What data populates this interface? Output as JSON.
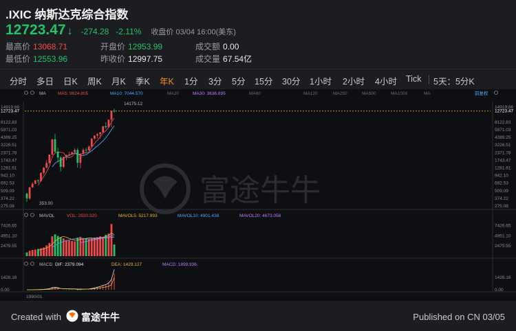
{
  "header": {
    "title": ".IXIC 纳斯达克综合指数",
    "price": "12723.47",
    "change": "-274.28",
    "change_pct": "-2.11%",
    "status": "收盘价  03/04 16:00(美东)",
    "stats": [
      {
        "label": "最高价",
        "value": "13068.71",
        "tone": "red"
      },
      {
        "label": "开盘价",
        "value": "12953.99",
        "tone": "green"
      },
      {
        "label": "成交额",
        "value": "0.00",
        "tone": "white"
      },
      {
        "label": "最低价",
        "value": "12553.96",
        "tone": "green"
      },
      {
        "label": "昨收价",
        "value": "12997.75",
        "tone": "white"
      },
      {
        "label": "成交量",
        "value": "67.54亿",
        "tone": "white"
      }
    ]
  },
  "tabs": [
    "分时",
    "多日",
    "日K",
    "周K",
    "月K",
    "季K",
    "年K",
    "1分",
    "3分",
    "5分",
    "15分",
    "30分",
    "1小时",
    "2小时",
    "4小时",
    "Tick",
    "5天：5分K"
  ],
  "active_tab": "年K",
  "main_legend": {
    "ma": "MA",
    "ma5": "MA5: 9624.805",
    "ma10": "MA10: 7044.570",
    "ma20": "MA20",
    "ma30": "MA30: 3636.695",
    "ma60": "MA60",
    "ma120": "MA120",
    "ma250": "MA250",
    "ma500": "MA500",
    "ma1000": "MA1000",
    "ma_more": "MA",
    "restore": "前复权",
    "hi_label": "14175.12",
    "lo_label": "353.00"
  },
  "yaxis_main": [
    "14919.86",
    "12723.47",
    "8122.83",
    "5971.03",
    "4389.25",
    "3226.51",
    "2371.78",
    "1743.47",
    "1281.61",
    "942.10",
    "692.53",
    "509.09",
    "374.22",
    "275.08"
  ],
  "vol_legend": {
    "name": "MAVOL",
    "vol": "VOL: 2830.320",
    "mavol5": "MAVOL5: 5217.993",
    "mavol10": "MAVOL10: 4901.438",
    "mavol20": "MAVOL20: 4673.058"
  },
  "yaxis_vol": [
    "7426.65",
    "4951.10",
    "2475.55"
  ],
  "macd_legend": {
    "name": "MACD",
    "dif": "DIF: 2379.094",
    "dea": "DEA: 1429.127",
    "macd": "MACD: 1899.936"
  },
  "yaxis_macd": [
    "1426.16",
    "0.00"
  ],
  "xaxis": [
    "1990/01"
  ],
  "watermark": "富途牛牛",
  "footer": {
    "created": "Created with",
    "brand": "富途牛牛",
    "published": "Published on CN 03/05"
  },
  "colors": {
    "up": "#f04848",
    "down": "#22c26a",
    "active": "#ff8a1e",
    "ma5": "#e84a5f",
    "ma10": "#4aa8ff",
    "ma30": "#c27bff",
    "mavol5": "#f0b429",
    "mavol10": "#4aa8ff",
    "mavol20": "#c27bff"
  },
  "chart_data": {
    "type": "candlestick",
    "title": ".IXIC 纳斯达克综合指数",
    "xlabel": "",
    "ylabel": "",
    "yscale": "log",
    "ylim": [
      275.08,
      14919.86
    ],
    "candles": [
      {
        "o": 454,
        "h": 470,
        "l": 325,
        "c": 374
      },
      {
        "o": 374,
        "h": 590,
        "l": 353,
        "c": 586
      },
      {
        "o": 586,
        "h": 720,
        "l": 570,
        "c": 677
      },
      {
        "o": 677,
        "h": 780,
        "l": 660,
        "c": 777
      },
      {
        "o": 777,
        "h": 805,
        "l": 690,
        "c": 752
      },
      {
        "o": 752,
        "h": 1070,
        "l": 740,
        "c": 1052
      },
      {
        "o": 1052,
        "h": 1325,
        "l": 980,
        "c": 1291
      },
      {
        "o": 1291,
        "h": 1750,
        "l": 1260,
        "c": 1570
      },
      {
        "o": 1570,
        "h": 2200,
        "l": 1500,
        "c": 2193
      },
      {
        "o": 2193,
        "h": 4100,
        "l": 2150,
        "c": 4069
      },
      {
        "o": 4069,
        "h": 5050,
        "l": 2330,
        "c": 2470
      },
      {
        "o": 2470,
        "h": 2900,
        "l": 1600,
        "c": 1950
      },
      {
        "o": 1950,
        "h": 2050,
        "l": 1110,
        "c": 1335
      },
      {
        "o": 1335,
        "h": 2010,
        "l": 1270,
        "c": 2003
      },
      {
        "o": 2003,
        "h": 2180,
        "l": 1750,
        "c": 2175
      },
      {
        "o": 2175,
        "h": 2470,
        "l": 2000,
        "c": 2205
      },
      {
        "o": 2205,
        "h": 2460,
        "l": 2200,
        "c": 2415
      },
      {
        "o": 2415,
        "h": 2860,
        "l": 2340,
        "c": 2652
      },
      {
        "o": 2652,
        "h": 2860,
        "l": 1300,
        "c": 1577
      },
      {
        "o": 1577,
        "h": 2300,
        "l": 1260,
        "c": 2269
      },
      {
        "o": 2269,
        "h": 2880,
        "l": 2060,
        "c": 2652
      },
      {
        "o": 2652,
        "h": 2890,
        "l": 2300,
        "c": 2605
      },
      {
        "o": 2605,
        "h": 3200,
        "l": 2560,
        "c": 3019
      },
      {
        "o": 3019,
        "h": 4250,
        "l": 3020,
        "c": 4176
      },
      {
        "o": 4176,
        "h": 4810,
        "l": 4080,
        "c": 4736
      },
      {
        "o": 4736,
        "h": 5230,
        "l": 4200,
        "c": 5007
      },
      {
        "o": 5007,
        "h": 5470,
        "l": 4210,
        "c": 5383
      },
      {
        "o": 5383,
        "h": 6950,
        "l": 5380,
        "c": 6903
      },
      {
        "o": 6903,
        "h": 8130,
        "l": 6190,
        "c": 6635
      },
      {
        "o": 6635,
        "h": 9050,
        "l": 6460,
        "c": 8973
      },
      {
        "o": 8973,
        "h": 12900,
        "l": 6630,
        "c": 12888
      },
      {
        "o": 12888,
        "h": 14175.12,
        "l": 11900,
        "c": 12723
      }
    ],
    "volume": [
      900,
      1300,
      1500,
      1600,
      1750,
      1900,
      2100,
      2600,
      3200,
      4800,
      5300,
      4900,
      4600,
      4300,
      3900,
      3800,
      3700,
      3600,
      4500,
      4700,
      4400,
      4300,
      4200,
      4300,
      4500,
      4600,
      4800,
      4700,
      5200,
      5500,
      7800,
      2830
    ],
    "macd": {
      "dif": [
        0,
        5,
        10,
        18,
        24,
        40,
        60,
        90,
        130,
        260,
        300,
        250,
        150,
        120,
        110,
        100,
        100,
        100,
        60,
        60,
        70,
        80,
        100,
        150,
        220,
        300,
        380,
        520,
        600,
        780,
        1200,
        2379
      ],
      "dea": [
        0,
        2,
        5,
        8,
        12,
        18,
        28,
        40,
        58,
        100,
        140,
        160,
        150,
        140,
        130,
        120,
        115,
        110,
        100,
        90,
        85,
        85,
        88,
        100,
        124,
        160,
        204,
        268,
        334,
        420,
        570,
        1429
      ],
      "hist": [
        0,
        6,
        10,
        20,
        24,
        44,
        64,
        100,
        144,
        320,
        320,
        180,
        0,
        -40,
        -40,
        -40,
        -30,
        -20,
        -80,
        -60,
        -30,
        -10,
        24,
        100,
        192,
        280,
        352,
        504,
        532,
        720,
        1260,
        1900
      ]
    }
  }
}
